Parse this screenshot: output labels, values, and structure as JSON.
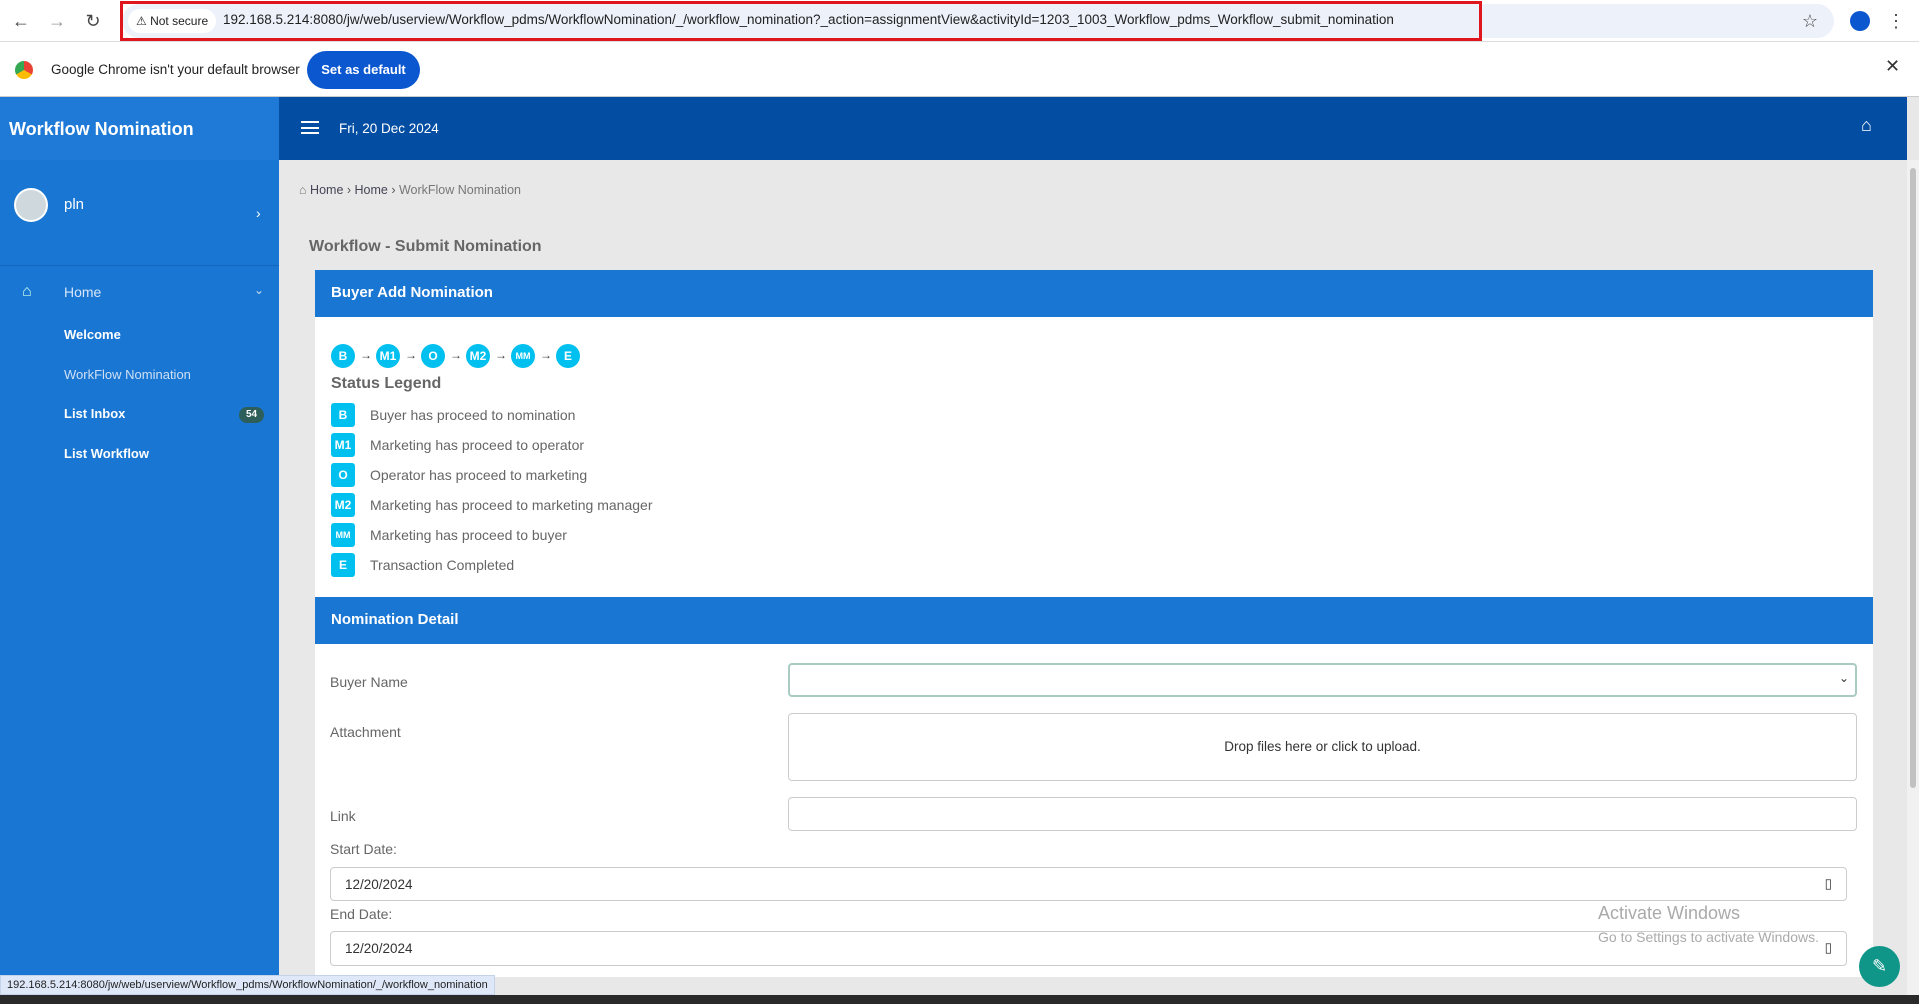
{
  "browser": {
    "not_secure": "Not secure",
    "url": "192.168.5.214:8080/jw/web/userview/Workflow_pdms/WorkflowNomination/_/workflow_nomination?_action=assignmentView&activityId=1203_1003_Workflow_pdms_Workflow_submit_nomination",
    "infobar_text": "Google Chrome isn't your default browser",
    "set_default": "Set as default",
    "status_url": "192.168.5.214:8080/jw/web/userview/Workflow_pdms/WorkflowNomination/_/workflow_nomination"
  },
  "app": {
    "title": "Workflow Nomination",
    "date": "Fri, 20 Dec 2024",
    "user": "pln"
  },
  "sidebar": {
    "home": "Home",
    "items": [
      {
        "label": "Welcome"
      },
      {
        "label": "WorkFlow Nomination"
      },
      {
        "label": "List Inbox",
        "badge": "54"
      },
      {
        "label": "List Workflow"
      }
    ]
  },
  "breadcrumb": [
    "Home",
    "Home",
    "WorkFlow Nomination"
  ],
  "page_title": "Workflow - Submit Nomination",
  "card1": {
    "title": "Buyer Add Nomination",
    "steps": [
      "B",
      "M1",
      "O",
      "M2",
      "MM",
      "E"
    ],
    "legend_title": "Status Legend",
    "legend": [
      {
        "code": "B",
        "text": "Buyer has proceed to nomination"
      },
      {
        "code": "M1",
        "text": "Marketing has proceed to operator"
      },
      {
        "code": "O",
        "text": "Operator has proceed to marketing"
      },
      {
        "code": "M2",
        "text": "Marketing has proceed to marketing manager"
      },
      {
        "code": "MM",
        "text": "Marketing has proceed to buyer"
      },
      {
        "code": "E",
        "text": "Transaction Completed"
      }
    ]
  },
  "card2": {
    "title": "Nomination Detail",
    "buyer_label": "Buyer Name",
    "buyer_value": "",
    "attachment_label": "Attachment",
    "dropzone": "Drop files here or click to upload.",
    "link_label": "Link",
    "link_value": "",
    "start_label": "Start Date:",
    "start_value": "12/20/2024",
    "end_label": "End Date:",
    "end_value": "12/20/2024"
  },
  "watermark": {
    "title": "Activate Windows",
    "sub": "Go to Settings to activate Windows."
  },
  "colors": {
    "primary": "#1976d2",
    "header": "#034ea2",
    "status": "#00c0ef"
  }
}
